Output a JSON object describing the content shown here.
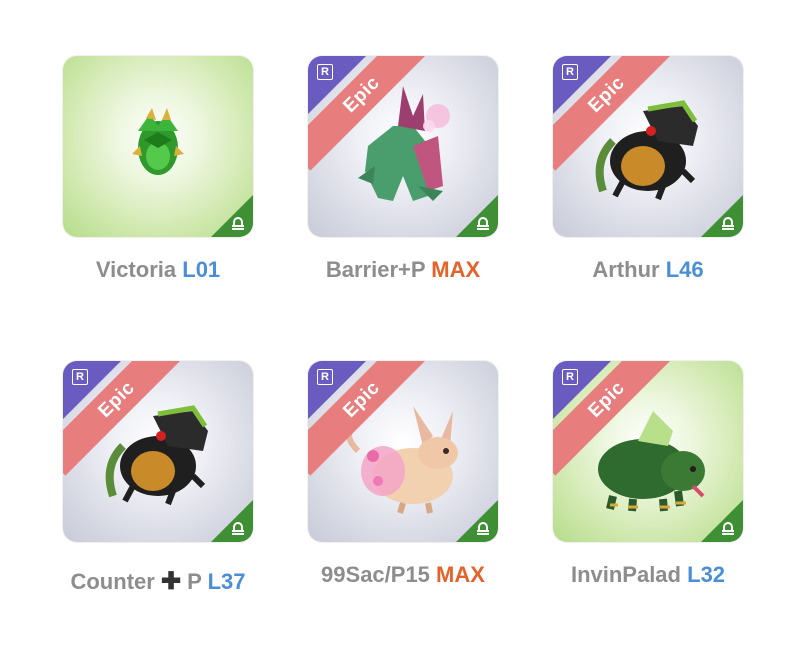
{
  "monsters": [
    {
      "name": "Victoria",
      "level": "L01",
      "level_color": "#4a8fd6",
      "rarity": "",
      "badge": "",
      "element": "wind-icon",
      "background": "green"
    },
    {
      "name": "Barrier+P",
      "level": "MAX",
      "level_color": "#e5622b",
      "rarity": "R",
      "badge": "Epic",
      "element": "wind-icon",
      "background": "grey"
    },
    {
      "name": "Arthur",
      "level": "L46",
      "level_color": "#4a8fd6",
      "rarity": "R",
      "badge": "Epic",
      "element": "wind-icon",
      "background": "grey"
    },
    {
      "name": "Counter",
      "name_suffix": "P",
      "plus_glyph": "✚",
      "level": "L37",
      "level_color": "#4a8fd6",
      "rarity": "R",
      "badge": "Epic",
      "element": "wind-icon",
      "background": "grey"
    },
    {
      "name": "99Sac/P15",
      "level": "MAX",
      "level_color": "#e5622b",
      "rarity": "R",
      "badge": "Epic",
      "element": "wind-icon",
      "background": "grey"
    },
    {
      "name": "InvinPalad",
      "level": "L32",
      "level_color": "#4a8fd6",
      "rarity": "R",
      "badge": "Epic",
      "element": "wind-icon",
      "background": "green"
    }
  ],
  "colors": {
    "epic_ribbon": "#e77d7d",
    "rarity_corner": "#6a5bc1",
    "element_corner": "#3f8f35",
    "name_grey": "#8d8d8d"
  }
}
